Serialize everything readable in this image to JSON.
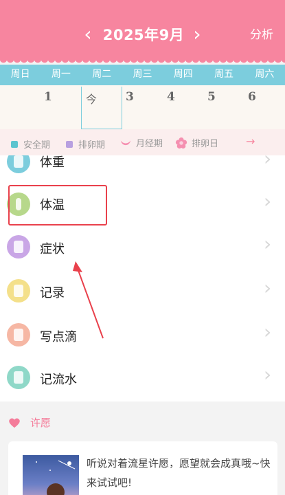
{
  "header": {
    "title": "2025年9月",
    "prev_glyph": "‹",
    "next_glyph": "›",
    "analyze_label": "分析",
    "bg_color": "#f7859f"
  },
  "week": {
    "days": [
      "周日",
      "周一",
      "周二",
      "周三",
      "周四",
      "周五",
      "周六"
    ],
    "color": "#7ccddd"
  },
  "dates": {
    "sun": "",
    "mon": "1",
    "today": "今",
    "wed": "3",
    "thu": "4",
    "fri": "5",
    "sat": "6"
  },
  "legend": {
    "safe": "安全期",
    "ovulation_period": "排卵期",
    "period": "月经期",
    "ovulation_day": "排卵日",
    "arrow": "→",
    "colors": {
      "safe": "#5cc4cf",
      "ovulation_period": "#b8a0e0",
      "period": "#f58fb0",
      "ovulation_day": "#f58fb0"
    }
  },
  "list": {
    "items": [
      {
        "label": "体重",
        "icon": "scale-icon",
        "color": "#7ccddd"
      },
      {
        "label": "体温",
        "icon": "thermometer-icon",
        "color": "#b7d88b"
      },
      {
        "label": "症状",
        "icon": "symptom-icon",
        "color": "#c9a6e6"
      },
      {
        "label": "记录",
        "icon": "note-icon",
        "color": "#f4e08a"
      },
      {
        "label": "写点滴",
        "icon": "diary-icon",
        "color": "#f6b7a4"
      },
      {
        "label": "记流水",
        "icon": "ledger-icon",
        "color": "#8fd8c8"
      }
    ],
    "chevron": "›"
  },
  "wish": {
    "title": "许愿",
    "text": "听说对着流星许愿，愿望就会成真哦~快来试试吧!",
    "heart_color": "#f47c9a"
  }
}
